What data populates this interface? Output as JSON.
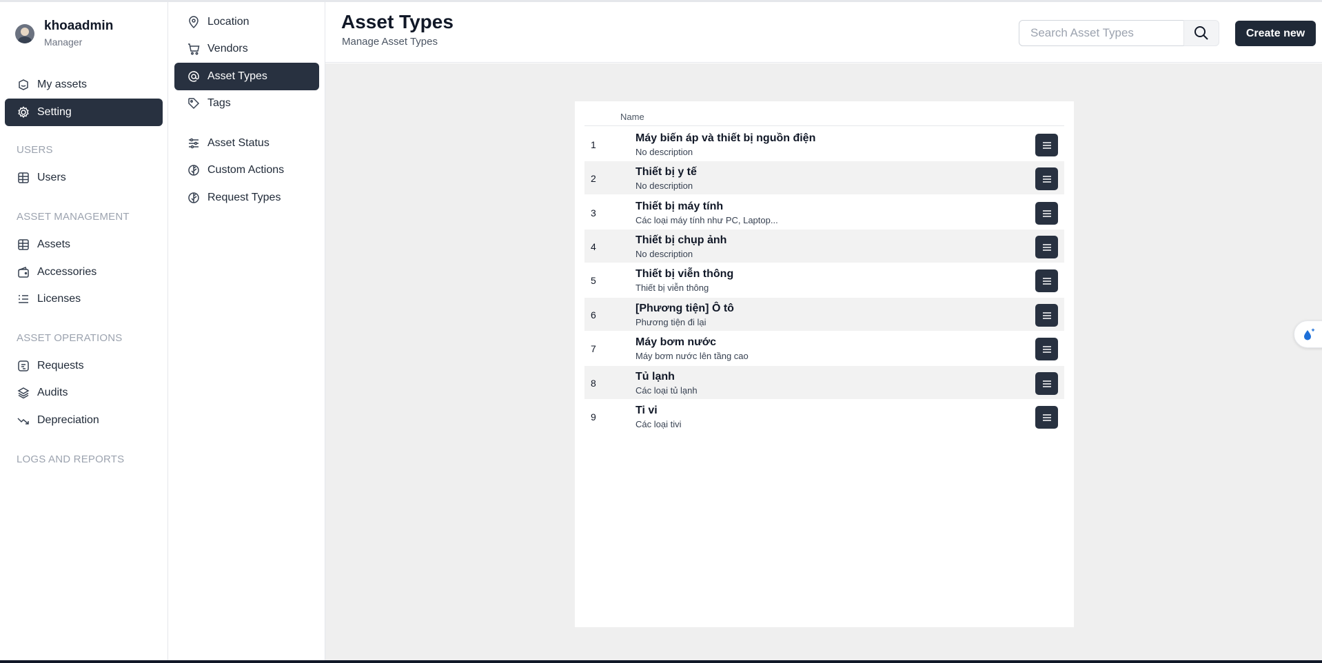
{
  "user": {
    "name": "khoaadmin",
    "role": "Manager"
  },
  "sidebar": {
    "top_items": [
      {
        "label": "My assets",
        "icon": "box-icon"
      },
      {
        "label": "Setting",
        "icon": "gear-icon"
      }
    ],
    "sections": {
      "users": {
        "title": "USERS",
        "items": [
          {
            "label": "Users",
            "icon": "grid-icon"
          }
        ]
      },
      "asset_management": {
        "title": "ASSET MANAGEMENT",
        "items": [
          {
            "label": "Assets",
            "icon": "grid-icon"
          },
          {
            "label": "Accessories",
            "icon": "wallet-icon"
          },
          {
            "label": "Licenses",
            "icon": "list-icon"
          }
        ]
      },
      "asset_operations": {
        "title": "ASSET OPERATIONS",
        "items": [
          {
            "label": "Requests",
            "icon": "request-icon"
          },
          {
            "label": "Audits",
            "icon": "layers-icon"
          },
          {
            "label": "Depreciation",
            "icon": "trend-down-icon"
          }
        ]
      },
      "logs": {
        "title": "LOGS AND REPORTS"
      }
    }
  },
  "subnav": {
    "items": [
      {
        "label": "Location",
        "icon": "location-pin-icon"
      },
      {
        "label": "Vendors",
        "icon": "cart-icon"
      },
      {
        "label": "Asset Types",
        "icon": "at-sign-icon"
      },
      {
        "label": "Tags",
        "icon": "tag-icon"
      },
      {
        "label": "Asset Status",
        "icon": "sliders-icon"
      },
      {
        "label": "Custom Actions",
        "icon": "leaf-icon"
      },
      {
        "label": "Request Types",
        "icon": "leaf-icon"
      }
    ]
  },
  "header": {
    "title": "Asset Types",
    "subtitle": "Manage Asset Types",
    "search_placeholder": "Search Asset Types",
    "create_label": "Create new"
  },
  "table": {
    "column_name": "Name",
    "rows": [
      {
        "index": "1",
        "name": "Máy biến áp và thiết bị nguồn điện",
        "description": "No description"
      },
      {
        "index": "2",
        "name": "Thiết bị y tế",
        "description": "No description"
      },
      {
        "index": "3",
        "name": "Thiết bị máy tính",
        "description": "Các loại máy tính như PC, Laptop..."
      },
      {
        "index": "4",
        "name": "Thiết bị chụp ảnh",
        "description": "No description"
      },
      {
        "index": "5",
        "name": "Thiết bị viễn thông",
        "description": "Thiết bị viễn thông"
      },
      {
        "index": "6",
        "name": "[Phương tiện] Ô tô",
        "description": "Phương tiện đi lại"
      },
      {
        "index": "7",
        "name": "Máy bơm nước",
        "description": "Máy bơm nước lên tầng cao"
      },
      {
        "index": "8",
        "name": "Tủ lạnh",
        "description": "Các loại tủ lạnh"
      },
      {
        "index": "9",
        "name": "Ti vi",
        "description": "Các loại tivi"
      }
    ]
  },
  "colors": {
    "active_bg": "#283140",
    "main_bg": "#efefef",
    "row_alt": "#f2f2f2"
  }
}
